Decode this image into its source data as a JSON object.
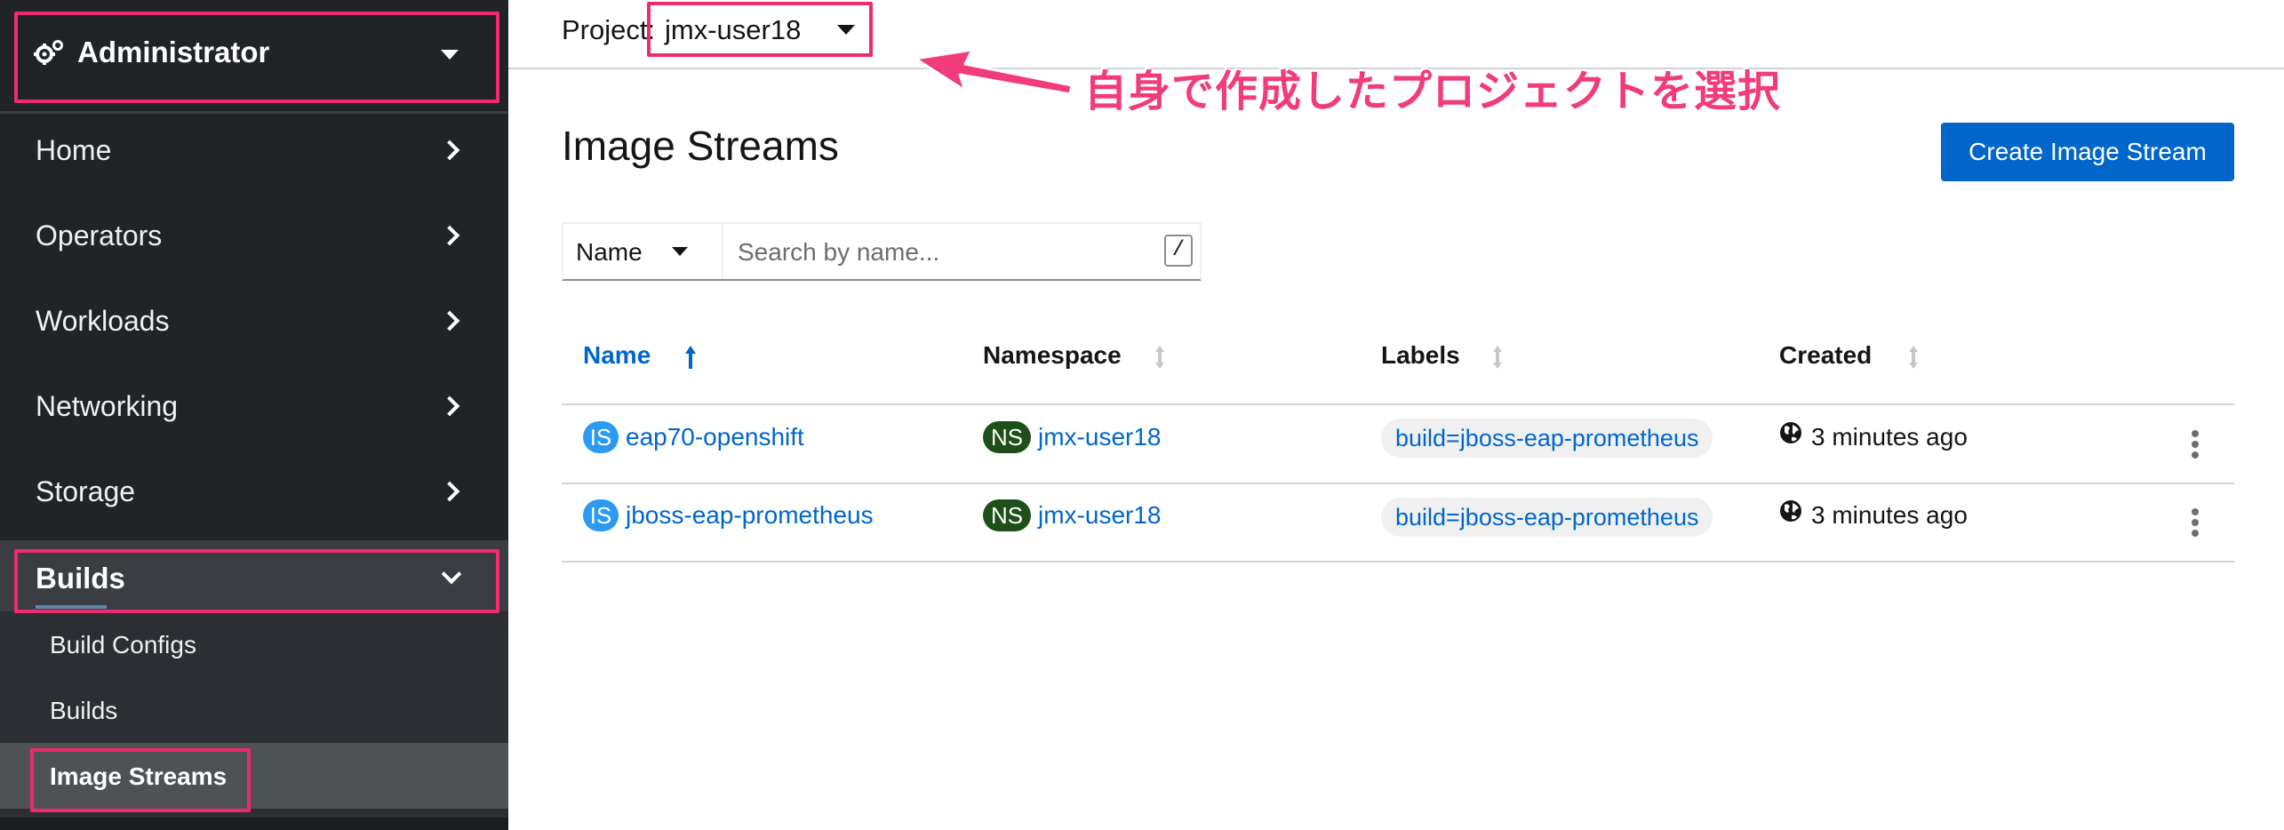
{
  "sidebar": {
    "perspective": "Administrator",
    "nav": [
      {
        "label": "Home"
      },
      {
        "label": "Operators"
      },
      {
        "label": "Workloads"
      },
      {
        "label": "Networking"
      },
      {
        "label": "Storage"
      }
    ],
    "builds": {
      "label": "Builds",
      "items": [
        {
          "label": "Build Configs"
        },
        {
          "label": "Builds"
        },
        {
          "label": "Image Streams"
        }
      ]
    }
  },
  "topbar": {
    "project_label": "Project:",
    "project_value": "jmx-user18"
  },
  "annotation": {
    "text": "自身で作成したプロジェクトを選択"
  },
  "page": {
    "title": "Image Streams",
    "create_button": "Create Image Stream"
  },
  "filter": {
    "type": "Name",
    "placeholder": "Search by name...",
    "shortcut": "/"
  },
  "table": {
    "columns": [
      "Name",
      "Namespace",
      "Labels",
      "Created"
    ],
    "rows": [
      {
        "kind_badge": "IS",
        "name": "eap70-openshift",
        "ns_badge": "NS",
        "namespace": "jmx-user18",
        "label": "build=jboss-eap-prometheus",
        "created": "3 minutes ago"
      },
      {
        "kind_badge": "IS",
        "name": "jboss-eap-prometheus",
        "ns_badge": "NS",
        "namespace": "jmx-user18",
        "label": "build=jboss-eap-prometheus",
        "created": "3 minutes ago"
      }
    ]
  },
  "colors": {
    "sidebar_bg": "#212427",
    "accent_blue": "#0066cc",
    "annotation_pink": "#f02b6d"
  }
}
